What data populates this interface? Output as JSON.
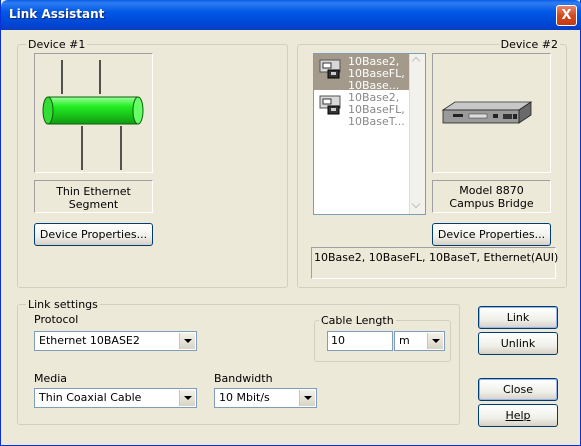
{
  "window": {
    "title": "Link Assistant",
    "close_glyph": "X"
  },
  "device1": {
    "group_label": "Device #1",
    "description": "Thin Ethernet Segment",
    "properties_button": "Device Properties...",
    "segment_color": "#22dd22"
  },
  "device2": {
    "group_label": "Device #2",
    "interfaces": [
      {
        "label": "10Base2,\n10BaseFL,\n10Base...",
        "icon": "port-icon",
        "selected": true
      },
      {
        "label": "10Base2,\n10BaseFL,\n10BaseT...",
        "icon": "port-icon",
        "selected": false
      }
    ],
    "description": "Model 8870 Campus Bridge",
    "properties_button": "Device Properties...",
    "interface_summary": "10Base2, 10BaseFL, 10BaseT, Ethernet(AUI)"
  },
  "link_settings": {
    "group_label": "Link settings",
    "protocol_label": "Protocol",
    "protocol_value": "Ethernet 10BASE2",
    "cable_length_label": "Cable Length",
    "cable_length_value": "10",
    "cable_length_unit": "m",
    "media_label": "Media",
    "media_value": "Thin Coaxial Cable",
    "bandwidth_label": "Bandwidth",
    "bandwidth_value": "10 Mbit/s"
  },
  "buttons": {
    "link": "Link",
    "unlink": "Unlink",
    "close": "Close",
    "help": "Help"
  }
}
